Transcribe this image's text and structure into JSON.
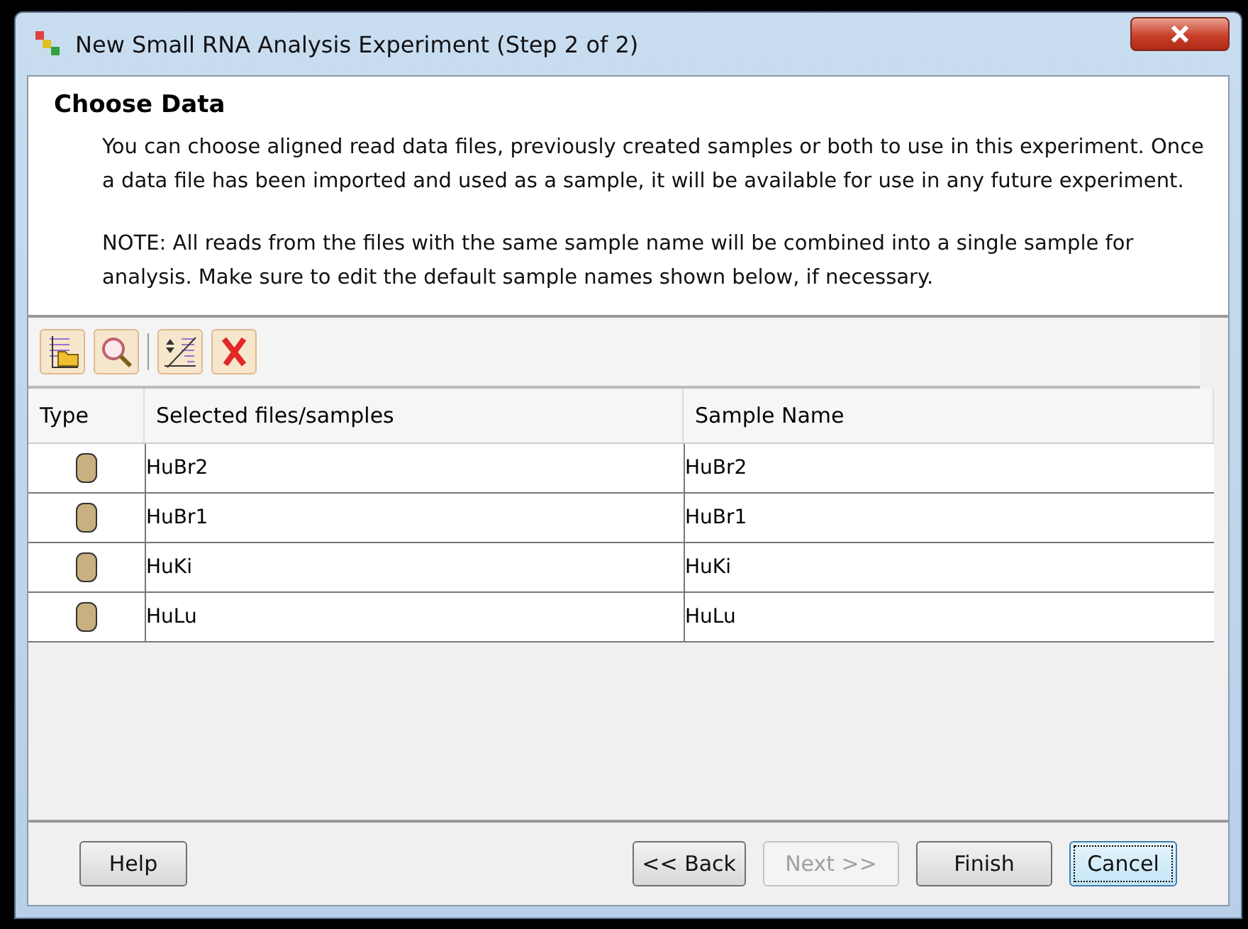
{
  "window": {
    "title": "New Small RNA Analysis Experiment (Step 2 of 2)"
  },
  "header": {
    "title": "Choose Data",
    "paragraphs": [
      "You can choose aligned read data files, previously created samples or both to use in this experiment. Once a data file has been imported and used as a sample, it will be available for use in any future experiment.",
      "NOTE: All reads from the files with the same sample name will be combined into a single sample for analysis. Make sure to edit the default sample names shown below, if necessary."
    ]
  },
  "toolbar": [
    {
      "kind": "add-folder"
    },
    {
      "kind": "search"
    },
    {
      "kind": "sort"
    },
    {
      "kind": "remove"
    }
  ],
  "table": {
    "columns": [
      "Type",
      "Selected files/samples",
      "Sample Name"
    ],
    "rows": [
      {
        "file": "HuBr2",
        "sample": "HuBr2"
      },
      {
        "file": "HuBr1",
        "sample": "HuBr1"
      },
      {
        "file": "HuKi",
        "sample": "HuKi"
      },
      {
        "file": "HuLu",
        "sample": "HuLu"
      }
    ]
  },
  "buttons": [
    {
      "label": "Help",
      "disabled": false,
      "focused": false
    },
    {
      "label": "<< Back",
      "disabled": false,
      "focused": false
    },
    {
      "label": "Next >>",
      "disabled": true,
      "focused": false
    },
    {
      "label": "Finish",
      "disabled": false,
      "focused": false
    },
    {
      "label": "Cancel",
      "disabled": false,
      "focused": true
    }
  ]
}
